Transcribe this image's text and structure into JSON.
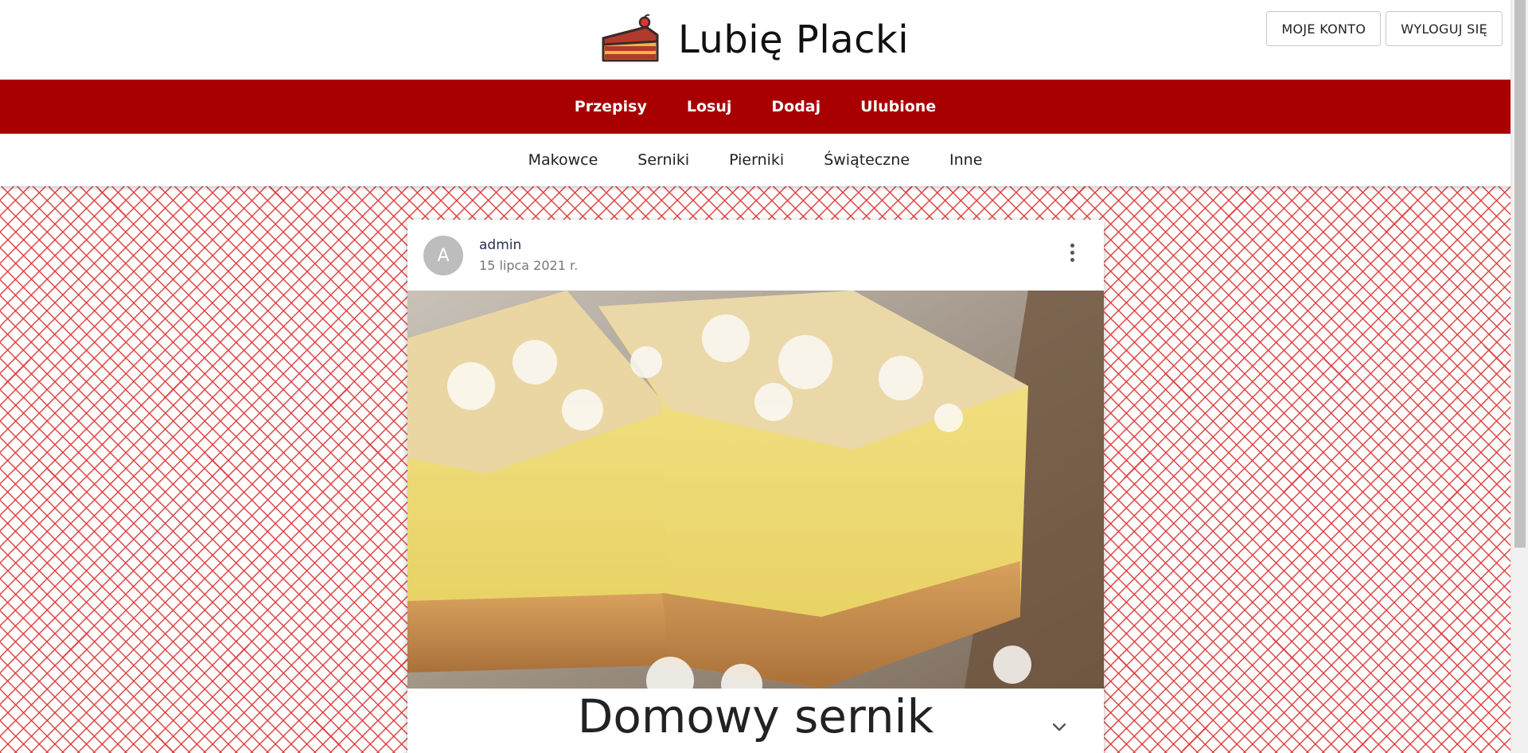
{
  "brand": {
    "title": "Lubię Placki",
    "logo_icon": "cake-slice-icon"
  },
  "account": {
    "my_account": "MOJE KONTO",
    "logout": "WYLOGUJ SIĘ"
  },
  "main_nav": [
    "Przepisy",
    "Losuj",
    "Dodaj",
    "Ulubione"
  ],
  "categories": [
    "Makowce",
    "Serniki",
    "Pierniki",
    "Świąteczne",
    "Inne"
  ],
  "post": {
    "avatar_letter": "A",
    "author": "admin",
    "date": "15 lipca 2021 r.",
    "title": "Domowy sernik",
    "image_icon": "cheesecake-photo"
  },
  "colors": {
    "nav_red": "#a80000",
    "pattern_red": "#e03a3a"
  }
}
